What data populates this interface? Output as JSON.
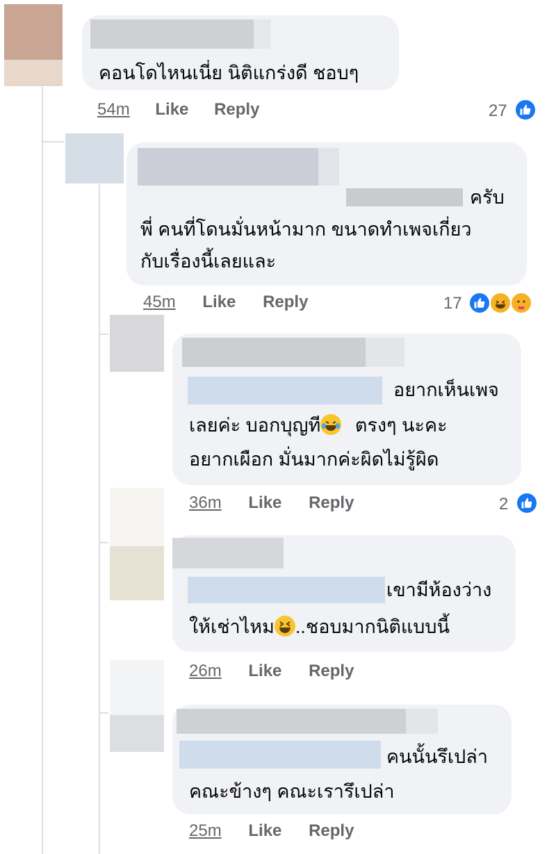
{
  "comments": [
    {
      "id": "c1",
      "text_lines": [
        "คอนโดไหนเนี่ย นิติแกร่งดี ชอบๆ"
      ],
      "time": "54m",
      "like": "Like",
      "reply": "Reply",
      "reaction_count": "27"
    },
    {
      "id": "c2",
      "text_lines": [
        "ครับ",
        "พี่ คนที่โดนมั่นหน้ามาก ขนาดทำเพจเกี่ยว",
        "กับเรื่องนี้เลยและ"
      ],
      "time": "45m",
      "like": "Like",
      "reply": "Reply",
      "reaction_count": "17"
    },
    {
      "id": "c3",
      "text_lines": [
        "อยากเห็นเพจ",
        "เลยค่ะ บอกบุญที",
        "ตรงๆ นะคะ",
        "อยากเผือก มั่นมากค่ะผิดไม่รู้ผิด"
      ],
      "time": "36m",
      "like": "Like",
      "reply": "Reply",
      "reaction_count": "2"
    },
    {
      "id": "c4",
      "text_lines": [
        "เขามีห้องว่าง",
        "ให้เช่าไหม",
        "..ชอบมากนิติแบบนี้"
      ],
      "time": "26m",
      "like": "Like",
      "reply": "Reply"
    },
    {
      "id": "c5",
      "text_lines": [
        "คนนั้นรึเปล่า",
        "คณะข้างๆ คณะเรารึเปล่า"
      ],
      "time": "25m",
      "like": "Like",
      "reply": "Reply"
    }
  ],
  "colors": {
    "bubble": "#f0f2f5",
    "meta": "#65676b",
    "like_blue": "#1877f2",
    "thread_line": "#dcdee2"
  },
  "icons": [
    "like-reaction-icon",
    "haha-reaction-icon",
    "care-reaction-icon",
    "laugh-tears-emoji",
    "grin-squint-emoji"
  ]
}
